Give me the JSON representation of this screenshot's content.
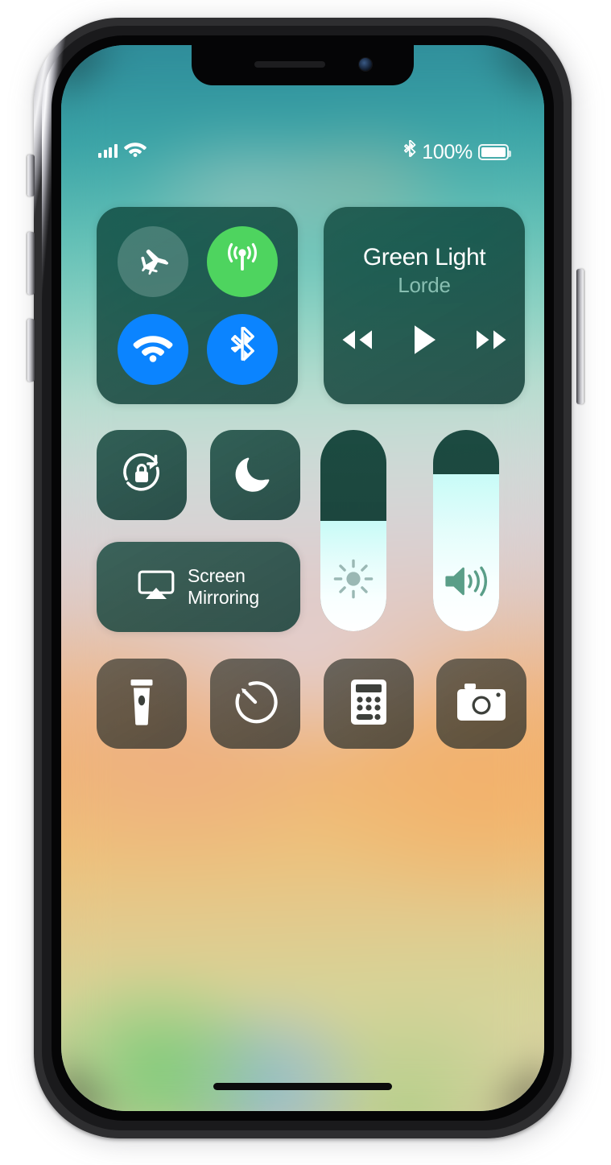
{
  "device": {
    "name": "iPhone X",
    "notch": {
      "speaker_name": "earpiece-speaker",
      "camera_name": "front-camera"
    },
    "buttons": {
      "ringer_switch": "Ring/Silent Switch",
      "volume_up": "Volume Up",
      "volume_down": "Volume Down",
      "side_button": "Side Button"
    }
  },
  "status_bar": {
    "cellular_signal_label": "Cellular Signal",
    "cellular_bars": 4,
    "wifi_label": "Wi-Fi",
    "bluetooth_label": "Bluetooth",
    "battery_percent": "100%",
    "battery_level": 100,
    "battery_label": "Battery"
  },
  "control_center": {
    "connectivity": {
      "airplane_mode": {
        "label": "Airplane Mode",
        "state": "off",
        "color": "#7f9e98"
      },
      "cellular_data": {
        "label": "Cellular Data",
        "state": "on",
        "color": "#4ed45f"
      },
      "wifi": {
        "label": "Wi-Fi",
        "state": "on",
        "color": "#0b84ff"
      },
      "bluetooth": {
        "label": "Bluetooth",
        "state": "on",
        "color": "#0b84ff"
      }
    },
    "now_playing": {
      "title": "Green Light",
      "artist": "Lorde",
      "rewind_label": "Rewind",
      "play_label": "Play",
      "forward_label": "Fast Forward",
      "playback_state": "paused"
    },
    "toggles": {
      "rotation_lock": {
        "label": "Portrait Orientation Lock",
        "state": "off"
      },
      "do_not_disturb": {
        "label": "Do Not Disturb",
        "state": "off"
      }
    },
    "screen_mirroring": {
      "line1": "Screen",
      "line2": "Mirroring"
    },
    "sliders": {
      "brightness": {
        "label": "Brightness",
        "value": 55
      },
      "volume": {
        "label": "Volume",
        "value": 78
      }
    },
    "shortcuts": [
      {
        "name": "flashlight",
        "label": "Flashlight"
      },
      {
        "name": "timer",
        "label": "Timer"
      },
      {
        "name": "calculator",
        "label": "Calculator"
      },
      {
        "name": "camera",
        "label": "Camera"
      }
    ]
  },
  "home_indicator": {
    "label": "Home Indicator"
  }
}
